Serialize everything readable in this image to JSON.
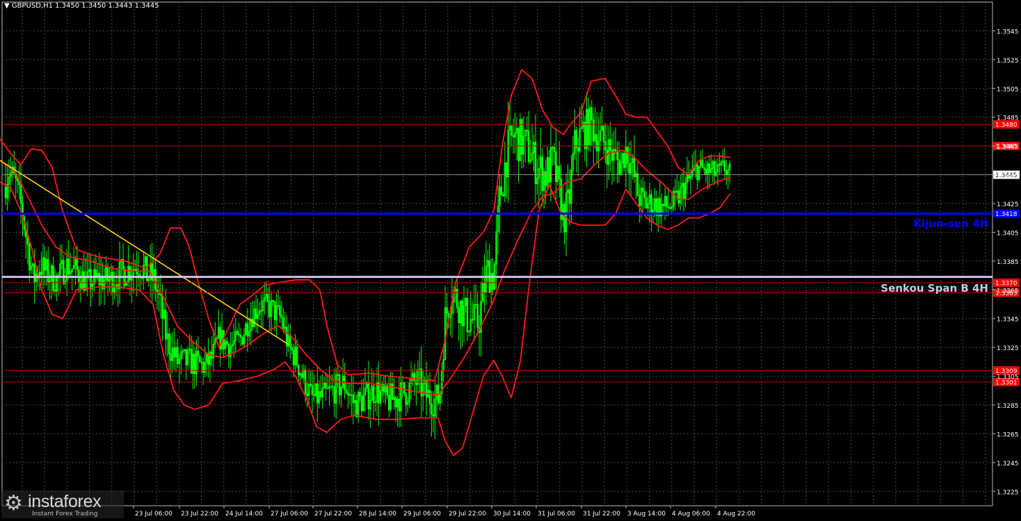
{
  "header": {
    "symbol_text": "GBPUSD,H1  1.3450 1.3450 1.3443 1.3445"
  },
  "logo": {
    "brand": "instaforex",
    "tagline": "Instant Forex Trading",
    "icon": "gear-icon"
  },
  "colors": {
    "background": "#000000",
    "grid": "#4a4a4a",
    "up_candle": "#00ff00",
    "axis_text": "#ffffff",
    "bollinger": "#ff1a1a",
    "kijun": "#0000ff",
    "senkou": "#d0c4e4",
    "trendline": "#ffd700",
    "level_line": "#c00000",
    "level_label_bg": "#ff0000"
  },
  "chart_data": {
    "type": "line",
    "subtype": "candlestick",
    "symbol": "GBPUSD",
    "timeframe": "H1",
    "ylim": [
      1.3215,
      1.3565
    ],
    "y_ticks": [
      "1.3545",
      "1.3525",
      "1.3505",
      "1.3485",
      "1.3465",
      "1.3445",
      "1.3425",
      "1.3405",
      "1.3385",
      "1.3365",
      "1.3345",
      "1.3325",
      "1.3305",
      "1.3285",
      "1.3265",
      "1.3245",
      "1.3225"
    ],
    "x_ticks": [
      "23 Jul 06:00",
      "23 Jul 22:00",
      "24 Jul 14:00",
      "27 Jul 06:00",
      "27 Jul 22:00",
      "28 Jul 14:00",
      "29 Jul 06:00",
      "29 Jul 22:00",
      "30 Jul 14:00",
      "31 Jul 06:00",
      "31 Jul 22:00",
      "3 Aug 14:00",
      "4 Aug 06:00",
      "4 Aug 22:00"
    ],
    "grid": true,
    "close_path": [
      [
        0,
        1.3425
      ],
      [
        12,
        1.3448
      ],
      [
        22,
        1.344
      ],
      [
        32,
        1.342
      ],
      [
        40,
        1.3395
      ],
      [
        48,
        1.3372
      ],
      [
        58,
        1.3382
      ],
      [
        70,
        1.3375
      ],
      [
        82,
        1.3372
      ],
      [
        95,
        1.3382
      ],
      [
        110,
        1.3378
      ],
      [
        125,
        1.337
      ],
      [
        140,
        1.3372
      ],
      [
        160,
        1.3372
      ],
      [
        180,
        1.3378
      ],
      [
        200,
        1.3383
      ],
      [
        212,
        1.3375
      ],
      [
        222,
        1.3372
      ],
      [
        230,
        1.3355
      ],
      [
        240,
        1.333
      ],
      [
        255,
        1.3315
      ],
      [
        272,
        1.3315
      ],
      [
        295,
        1.3312
      ],
      [
        305,
        1.3318
      ],
      [
        315,
        1.3332
      ],
      [
        330,
        1.3326
      ],
      [
        345,
        1.333
      ],
      [
        360,
        1.3346
      ],
      [
        375,
        1.3355
      ],
      [
        390,
        1.3352
      ],
      [
        405,
        1.3345
      ],
      [
        415,
        1.3325
      ],
      [
        425,
        1.3318
      ],
      [
        435,
        1.3305
      ],
      [
        448,
        1.329
      ],
      [
        462,
        1.329
      ],
      [
        478,
        1.3295
      ],
      [
        495,
        1.33
      ],
      [
        510,
        1.3285
      ],
      [
        525,
        1.329
      ],
      [
        540,
        1.3296
      ],
      [
        555,
        1.3288
      ],
      [
        570,
        1.329
      ],
      [
        585,
        1.3295
      ],
      [
        600,
        1.3302
      ],
      [
        612,
        1.3292
      ],
      [
        625,
        1.3288
      ],
      [
        632,
        1.329
      ],
      [
        640,
        1.3345
      ],
      [
        650,
        1.3365
      ],
      [
        660,
        1.3355
      ],
      [
        672,
        1.3345
      ],
      [
        688,
        1.3342
      ],
      [
        700,
        1.3378
      ],
      [
        710,
        1.3375
      ],
      [
        718,
        1.3425
      ],
      [
        728,
        1.3458
      ],
      [
        738,
        1.3472
      ],
      [
        750,
        1.3468
      ],
      [
        762,
        1.3462
      ],
      [
        772,
        1.345
      ],
      [
        785,
        1.3445
      ],
      [
        795,
        1.3455
      ],
      [
        805,
        1.343
      ],
      [
        810,
        1.3415
      ],
      [
        818,
        1.3425
      ],
      [
        826,
        1.3465
      ],
      [
        838,
        1.3475
      ],
      [
        850,
        1.348
      ],
      [
        860,
        1.3472
      ],
      [
        872,
        1.3465
      ],
      [
        882,
        1.3458
      ],
      [
        892,
        1.3452
      ],
      [
        900,
        1.3463
      ],
      [
        910,
        1.3448
      ],
      [
        918,
        1.343
      ],
      [
        928,
        1.3425
      ],
      [
        940,
        1.3425
      ],
      [
        955,
        1.3422
      ],
      [
        970,
        1.3425
      ],
      [
        982,
        1.3435
      ],
      [
        992,
        1.3442
      ],
      [
        1002,
        1.345
      ],
      [
        1012,
        1.3448
      ],
      [
        1022,
        1.3447
      ],
      [
        1032,
        1.3446
      ],
      [
        1042,
        1.345
      ],
      [
        1050,
        1.3445
      ]
    ],
    "volatility_scale": [
      [
        0,
        3
      ],
      [
        120,
        2.5
      ],
      [
        220,
        3
      ],
      [
        330,
        2.2
      ],
      [
        440,
        2.5
      ],
      [
        620,
        3
      ],
      [
        660,
        3.5
      ],
      [
        740,
        4
      ],
      [
        850,
        3.5
      ],
      [
        950,
        2.5
      ],
      [
        1050,
        2
      ]
    ],
    "series": [
      {
        "name": "",
        "style": "bollinger-upper",
        "points": [
          [
            0,
            1.347
          ],
          [
            15,
            1.346
          ],
          [
            30,
            1.3452
          ],
          [
            45,
            1.3463
          ],
          [
            60,
            1.3462
          ],
          [
            75,
            1.345
          ],
          [
            90,
            1.342
          ],
          [
            110,
            1.3393
          ],
          [
            140,
            1.3388
          ],
          [
            180,
            1.3385
          ],
          [
            210,
            1.338
          ],
          [
            230,
            1.339
          ],
          [
            245,
            1.3408
          ],
          [
            260,
            1.3408
          ],
          [
            272,
            1.3395
          ],
          [
            285,
            1.337
          ],
          [
            300,
            1.3345
          ],
          [
            315,
            1.3325
          ],
          [
            330,
            1.334
          ],
          [
            345,
            1.3355
          ],
          [
            360,
            1.336
          ],
          [
            380,
            1.3368
          ],
          [
            400,
            1.337
          ],
          [
            425,
            1.3372
          ],
          [
            445,
            1.3372
          ],
          [
            460,
            1.3365
          ],
          [
            470,
            1.334
          ],
          [
            485,
            1.3313
          ],
          [
            500,
            1.3306
          ],
          [
            530,
            1.3307
          ],
          [
            560,
            1.3305
          ],
          [
            600,
            1.3303
          ],
          [
            625,
            1.3302
          ],
          [
            640,
            1.333
          ],
          [
            655,
            1.337
          ],
          [
            675,
            1.3395
          ],
          [
            695,
            1.3405
          ],
          [
            710,
            1.342
          ],
          [
            722,
            1.3465
          ],
          [
            735,
            1.35
          ],
          [
            750,
            1.3518
          ],
          [
            765,
            1.3512
          ],
          [
            780,
            1.349
          ],
          [
            795,
            1.3478
          ],
          [
            810,
            1.3473
          ],
          [
            820,
            1.348
          ],
          [
            835,
            1.3488
          ],
          [
            850,
            1.351
          ],
          [
            870,
            1.3512
          ],
          [
            885,
            1.35
          ],
          [
            900,
            1.3487
          ],
          [
            915,
            1.3485
          ],
          [
            930,
            1.3485
          ],
          [
            945,
            1.3475
          ],
          [
            960,
            1.3465
          ],
          [
            975,
            1.345
          ],
          [
            990,
            1.3445
          ],
          [
            1005,
            1.3455
          ],
          [
            1020,
            1.3458
          ],
          [
            1035,
            1.3458
          ],
          [
            1050,
            1.3457
          ]
        ]
      },
      {
        "name": "",
        "style": "bollinger-middle",
        "points": [
          [
            0,
            1.3455
          ],
          [
            20,
            1.3448
          ],
          [
            40,
            1.343
          ],
          [
            60,
            1.341
          ],
          [
            80,
            1.3395
          ],
          [
            100,
            1.3388
          ],
          [
            130,
            1.3385
          ],
          [
            160,
            1.338
          ],
          [
            190,
            1.3378
          ],
          [
            215,
            1.3378
          ],
          [
            235,
            1.336
          ],
          [
            255,
            1.334
          ],
          [
            275,
            1.333
          ],
          [
            300,
            1.332
          ],
          [
            320,
            1.3318
          ],
          [
            340,
            1.3322
          ],
          [
            360,
            1.3328
          ],
          [
            380,
            1.3335
          ],
          [
            400,
            1.334
          ],
          [
            420,
            1.3332
          ],
          [
            440,
            1.332
          ],
          [
            460,
            1.331
          ],
          [
            480,
            1.3302
          ],
          [
            500,
            1.33
          ],
          [
            530,
            1.33
          ],
          [
            560,
            1.3298
          ],
          [
            600,
            1.3294
          ],
          [
            630,
            1.3292
          ],
          [
            650,
            1.3305
          ],
          [
            670,
            1.332
          ],
          [
            690,
            1.3338
          ],
          [
            710,
            1.3358
          ],
          [
            725,
            1.3378
          ],
          [
            745,
            1.34
          ],
          [
            765,
            1.342
          ],
          [
            780,
            1.343
          ],
          [
            795,
            1.3432
          ],
          [
            815,
            1.344
          ],
          [
            835,
            1.3442
          ],
          [
            855,
            1.3452
          ],
          [
            875,
            1.346
          ],
          [
            895,
            1.3462
          ],
          [
            910,
            1.3458
          ],
          [
            930,
            1.3448
          ],
          [
            955,
            1.3438
          ],
          [
            975,
            1.3428
          ],
          [
            990,
            1.3428
          ],
          [
            1010,
            1.3435
          ],
          [
            1030,
            1.344
          ],
          [
            1050,
            1.3443
          ]
        ]
      },
      {
        "name": "",
        "style": "bollinger-lower",
        "points": [
          [
            0,
            1.344
          ],
          [
            15,
            1.3436
          ],
          [
            30,
            1.342
          ],
          [
            45,
            1.3395
          ],
          [
            60,
            1.3365
          ],
          [
            75,
            1.3348
          ],
          [
            90,
            1.3345
          ],
          [
            110,
            1.3365
          ],
          [
            140,
            1.3367
          ],
          [
            170,
            1.3367
          ],
          [
            200,
            1.3365
          ],
          [
            220,
            1.3355
          ],
          [
            235,
            1.332
          ],
          [
            250,
            1.3295
          ],
          [
            265,
            1.3285
          ],
          [
            280,
            1.3282
          ],
          [
            300,
            1.3285
          ],
          [
            320,
            1.33
          ],
          [
            345,
            1.3302
          ],
          [
            370,
            1.3305
          ],
          [
            395,
            1.331
          ],
          [
            410,
            1.3315
          ],
          [
            425,
            1.3305
          ],
          [
            440,
            1.329
          ],
          [
            455,
            1.327
          ],
          [
            470,
            1.3266
          ],
          [
            490,
            1.3275
          ],
          [
            510,
            1.3278
          ],
          [
            540,
            1.3275
          ],
          [
            570,
            1.3275
          ],
          [
            600,
            1.3276
          ],
          [
            630,
            1.3276
          ],
          [
            640,
            1.326
          ],
          [
            652,
            1.325
          ],
          [
            665,
            1.3255
          ],
          [
            680,
            1.328
          ],
          [
            695,
            1.3305
          ],
          [
            710,
            1.3316
          ],
          [
            722,
            1.3305
          ],
          [
            735,
            1.329
          ],
          [
            748,
            1.3315
          ],
          [
            760,
            1.3365
          ],
          [
            775,
            1.342
          ],
          [
            790,
            1.3438
          ],
          [
            805,
            1.342
          ],
          [
            820,
            1.3412
          ],
          [
            835,
            1.341
          ],
          [
            855,
            1.341
          ],
          [
            870,
            1.341
          ],
          [
            885,
            1.3418
          ],
          [
            900,
            1.3435
          ],
          [
            915,
            1.3425
          ],
          [
            930,
            1.3415
          ],
          [
            945,
            1.341
          ],
          [
            960,
            1.3407
          ],
          [
            975,
            1.341
          ],
          [
            990,
            1.3415
          ],
          [
            1005,
            1.3415
          ],
          [
            1020,
            1.3418
          ],
          [
            1035,
            1.3422
          ],
          [
            1050,
            1.3432
          ]
        ]
      },
      {
        "name": "",
        "style": "trendline",
        "points": [
          [
            0,
            1.3455
          ],
          [
            415,
            1.3327
          ]
        ]
      }
    ],
    "levels": [
      {
        "value": 1.348,
        "label": "1.3480",
        "kind": "resistance"
      },
      {
        "value": 1.3465,
        "label": "1.3465",
        "kind": "resistance"
      },
      {
        "value": 1.3445,
        "label": "1.3445",
        "kind": "price"
      },
      {
        "value": 1.3418,
        "label": "1.3418",
        "kind": "kijun"
      },
      {
        "value": 1.337,
        "label": "1.3370",
        "kind": "support"
      },
      {
        "value": 1.3374,
        "label": "",
        "kind": "senkou"
      },
      {
        "value": 1.3363,
        "label": "1.3363",
        "kind": "support"
      },
      {
        "value": 1.3309,
        "label": "1.3309",
        "kind": "support"
      },
      {
        "value": 1.3301,
        "label": "1.3301",
        "kind": "support"
      }
    ],
    "annotations": [
      {
        "text": "Kijun-sen 4H",
        "y": 1.3411,
        "color": "#0000ff"
      },
      {
        "text": "Senkou Span B 4H",
        "y": 1.3366,
        "color": "#d0c4e4"
      }
    ]
  }
}
